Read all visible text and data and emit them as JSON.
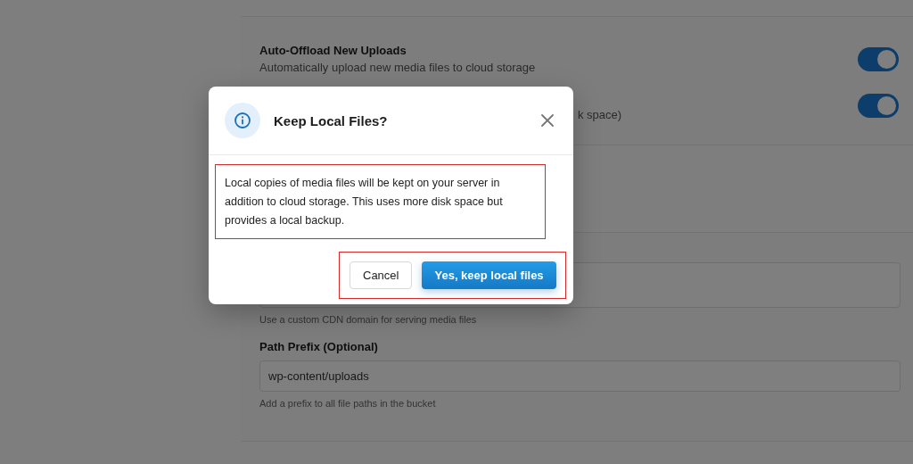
{
  "settings": [
    {
      "title": "Auto-Offload New Uploads",
      "description": "Automatically upload new media files to cloud storage",
      "on": true
    },
    {
      "description": "k space)",
      "on": true
    }
  ],
  "cdn_field": {
    "hint": "Use a custom CDN domain for serving media files"
  },
  "path_prefix": {
    "label": "Path Prefix (Optional)",
    "value": "wp-content/uploads",
    "hint": "Add a prefix to all file paths in the bucket"
  },
  "dialog": {
    "title": "Keep Local Files?",
    "message": "Local copies of media files will be kept on your server in addition to cloud storage. This uses more disk space but provides a local backup.",
    "buttons": [
      {
        "label": "Cancel",
        "kind": "secondary"
      },
      {
        "label": "Yes, keep local files",
        "kind": "primary"
      }
    ]
  }
}
